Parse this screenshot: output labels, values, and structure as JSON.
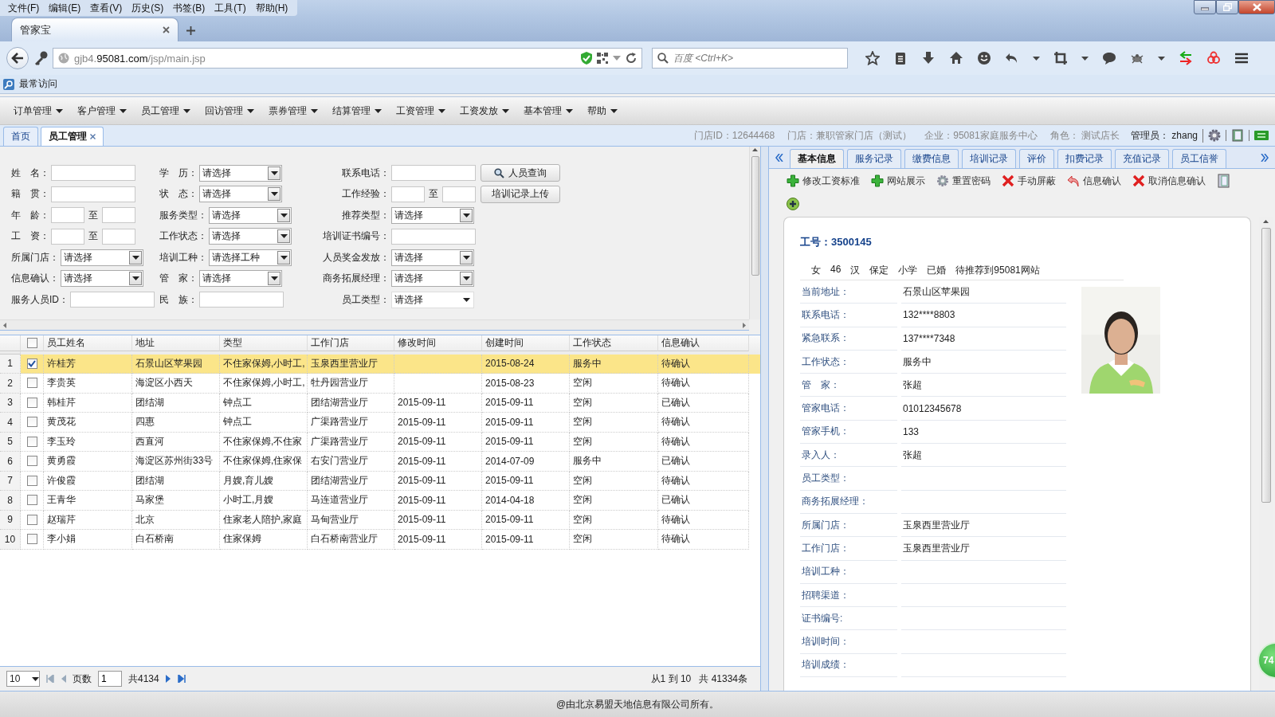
{
  "browser": {
    "menu": [
      "文件(F)",
      "编辑(E)",
      "查看(V)",
      "历史(S)",
      "书签(B)",
      "工具(T)",
      "帮助(H)"
    ],
    "tab": {
      "title": "管家宝"
    },
    "address": {
      "prefix": "gjb4.",
      "domain": "95081.com",
      "path": "/jsp/main.jsp"
    },
    "search": {
      "placeholder": "百度 <Ctrl+K>"
    },
    "bookmarks": [
      "最常访问"
    ]
  },
  "app_menu": [
    "订单管理",
    "客户管理",
    "员工管理",
    "回访管理",
    "票券管理",
    "结算管理",
    "工资管理",
    "工资发放",
    "基本管理",
    "帮助"
  ],
  "app_tabs": [
    {
      "label": "首页",
      "selected": false,
      "closable": false
    },
    {
      "label": "员工管理",
      "selected": true,
      "closable": true
    }
  ],
  "header_info": [
    "门店ID：12644468",
    "门店：兼职管家门店（测试）",
    "企业：95081家庭服务中心",
    "角色： 测试店长"
  ],
  "admin": "管理员： zhang",
  "search_form": {
    "rows": [
      [
        {
          "kind": "text",
          "label": "姓　名："
        },
        {
          "kind": "select",
          "label": "学　历：",
          "value": "请选择"
        },
        {
          "kind": "text",
          "label": "联系电话："
        },
        {
          "kind": "search_button",
          "label": "人员查询"
        }
      ],
      [
        {
          "kind": "text",
          "label": "籍　贯："
        },
        {
          "kind": "select",
          "label": "状　态：",
          "value": "请选择"
        },
        {
          "kind": "range",
          "label": "工作经验：",
          "separator": "至"
        },
        {
          "kind": "button",
          "label": "培训记录上传"
        }
      ],
      [
        {
          "kind": "range",
          "label": "年　龄：",
          "separator": "至"
        },
        {
          "kind": "select",
          "label": "服务类型：",
          "value": "请选择"
        },
        {
          "kind": "select",
          "label": "推荐类型：",
          "value": "请选择"
        }
      ],
      [
        {
          "kind": "range",
          "label": "工　资：",
          "separator": "至"
        },
        {
          "kind": "select",
          "label": "工作状态：",
          "value": "请选择"
        },
        {
          "kind": "text",
          "label": "培训证书编号："
        }
      ],
      [
        {
          "kind": "select",
          "label": "所属门店：",
          "value": "请选择"
        },
        {
          "kind": "select",
          "label": "培训工种：",
          "value": "请选择工种"
        },
        {
          "kind": "select",
          "label": "人员奖金发放：",
          "value": "请选择"
        }
      ],
      [
        {
          "kind": "select",
          "label": "信息确认：",
          "value": "请选择"
        },
        {
          "kind": "select",
          "label": "管　家：",
          "value": "请选择"
        },
        {
          "kind": "select",
          "label": "商务拓展经理：",
          "value": "请选择"
        }
      ],
      [
        {
          "kind": "text",
          "label": "服务人员ID："
        },
        {
          "kind": "text",
          "label": "民　族："
        },
        {
          "kind": "plain_select",
          "label": "员工类型：",
          "value": "请选择"
        }
      ]
    ]
  },
  "table": {
    "select_all": {
      "checked": false
    },
    "columns": [
      "员工姓名",
      "地址",
      "类型",
      "工作门店",
      "修改时间",
      "创建时间",
      "工作状态",
      "信息确认"
    ],
    "rows": [
      {
        "index": "1",
        "checked": true,
        "selected": true,
        "cells": [
          "许桂芳",
          "石景山区苹果园",
          "不住家保姆,小时工,",
          "玉泉西里营业厅",
          "",
          "2015-08-24",
          "服务中",
          "待确认"
        ]
      },
      {
        "index": "2",
        "checked": false,
        "selected": false,
        "cells": [
          "李贵英",
          "海淀区小西天",
          "不住家保姆,小时工,",
          "牡丹园营业厅",
          "",
          "2015-08-23",
          "空闲",
          "待确认"
        ]
      },
      {
        "index": "3",
        "checked": false,
        "selected": false,
        "cells": [
          "韩桂芹",
          "团结湖",
          "钟点工",
          "团结湖营业厅",
          "2015-09-11",
          "2015-09-11",
          "空闲",
          "已确认"
        ]
      },
      {
        "index": "4",
        "checked": false,
        "selected": false,
        "cells": [
          "黄茂花",
          "四惠",
          "钟点工",
          "广渠路营业厅",
          "2015-09-11",
          "2015-09-11",
          "空闲",
          "待确认"
        ]
      },
      {
        "index": "5",
        "checked": false,
        "selected": false,
        "cells": [
          "李玉玲",
          "西直河",
          "不住家保姆,不住家",
          "广渠路营业厅",
          "2015-09-11",
          "2015-09-11",
          "空闲",
          "待确认"
        ]
      },
      {
        "index": "6",
        "checked": false,
        "selected": false,
        "cells": [
          "黄勇霞",
          "海淀区苏州街33号",
          "不住家保姆,住家保",
          "右安门营业厅",
          "2015-09-11",
          "2014-07-09",
          "服务中",
          "已确认"
        ]
      },
      {
        "index": "7",
        "checked": false,
        "selected": false,
        "cells": [
          "许俊霞",
          "团结湖",
          "月嫂,育儿嫂",
          "团结湖营业厅",
          "2015-09-11",
          "2015-09-11",
          "空闲",
          "待确认"
        ]
      },
      {
        "index": "8",
        "checked": false,
        "selected": false,
        "cells": [
          "王青华",
          "马家堡",
          "小时工,月嫂",
          "马连道营业厅",
          "2015-09-11",
          "2014-04-18",
          "空闲",
          "已确认"
        ]
      },
      {
        "index": "9",
        "checked": false,
        "selected": false,
        "cells": [
          "赵瑞芹",
          "北京",
          "住家老人陪护,家庭",
          "马甸营业厅",
          "2015-09-11",
          "2015-09-11",
          "空闲",
          "待确认"
        ]
      },
      {
        "index": "10",
        "checked": false,
        "selected": false,
        "cells": [
          "李小娟",
          "白石桥南",
          "住家保姆",
          "白石桥南营业厅",
          "2015-09-11",
          "2015-09-11",
          "空闲",
          "待确认"
        ]
      }
    ]
  },
  "pager": {
    "page_size": "10",
    "page_label": "页数",
    "page": "1",
    "page_count": "共4134",
    "range": "从1 到 10",
    "total": "共 41334条"
  },
  "detail": {
    "tabs": [
      {
        "label": "基本信息",
        "selected": true
      },
      {
        "label": "服务记录",
        "selected": false
      },
      {
        "label": "缴费信息",
        "selected": false
      },
      {
        "label": "培训记录",
        "selected": false
      },
      {
        "label": "评价",
        "selected": false
      },
      {
        "label": "扣费记录",
        "selected": false
      },
      {
        "label": "充值记录",
        "selected": false
      },
      {
        "label": "员工信誉",
        "selected": false
      }
    ],
    "actions": [
      {
        "kind": "add",
        "label": "修改工资标准"
      },
      {
        "kind": "add",
        "label": "网站展示"
      },
      {
        "kind": "settings",
        "label": "重置密码"
      },
      {
        "kind": "remove",
        "label": "手动屏蔽"
      },
      {
        "kind": "revert",
        "label": "信息确认"
      },
      {
        "kind": "remove",
        "label": "取消信息确认"
      }
    ],
    "employee_id": "工号：3500145",
    "summary": [
      "女",
      "46",
      "汉",
      "保定",
      "小学",
      "已婚",
      "待推荐到95081网站"
    ],
    "fields": [
      {
        "label": "当前地址：",
        "value": "石景山区苹果园"
      },
      {
        "label": "联系电话：",
        "value": "132****8803"
      },
      {
        "label": "紧急联系：",
        "value": "137****7348"
      },
      {
        "label": "工作状态：",
        "value": "服务中"
      },
      {
        "label": "管　家：",
        "value": "张超"
      },
      {
        "label": "管家电话：",
        "value": "01012345678"
      },
      {
        "label": "管家手机：",
        "value": "133"
      },
      {
        "label": "录入人：",
        "value": "张超"
      },
      {
        "label": "员工类型："
      },
      {
        "label": "商务拓展经理："
      },
      {
        "label": "所属门店：",
        "value": "玉泉西里营业厅"
      },
      {
        "label": "工作门店：",
        "value": "玉泉西里营业厅"
      },
      {
        "label": "培训工种："
      },
      {
        "label": "招聘渠道："
      },
      {
        "label": "证书编号:"
      },
      {
        "label": "培训时间："
      },
      {
        "label": "培训成绩："
      }
    ],
    "photo": {
      "kind": "picture"
    }
  },
  "badge": "74",
  "footer": "@由北京易盟天地信息有限公司所有。"
}
